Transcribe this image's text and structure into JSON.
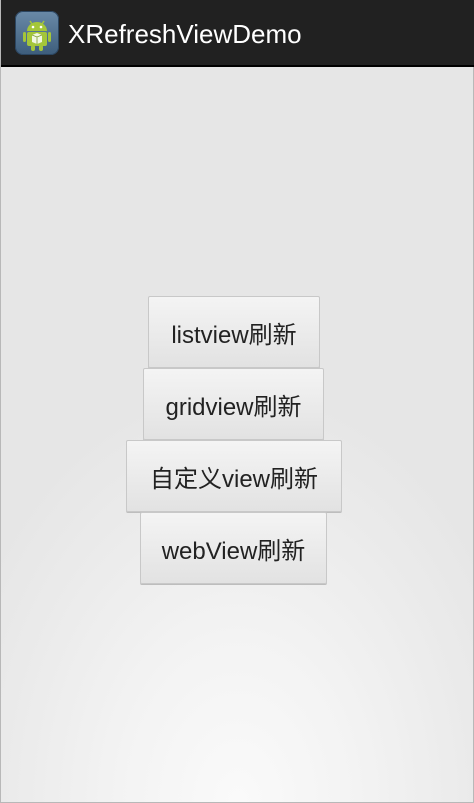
{
  "action_bar": {
    "title": "XRefreshViewDemo",
    "icon": "android-robot-icon"
  },
  "buttons": [
    {
      "label": "listview刷新"
    },
    {
      "label": "gridview刷新"
    },
    {
      "label": "自定义view刷新"
    },
    {
      "label": "webView刷新"
    }
  ],
  "colors": {
    "action_bar_bg": "#212121",
    "app_icon_bg": "#4a6a8a",
    "android_green": "#a4c639",
    "button_text": "#222222",
    "background": "#e8e8e8"
  }
}
